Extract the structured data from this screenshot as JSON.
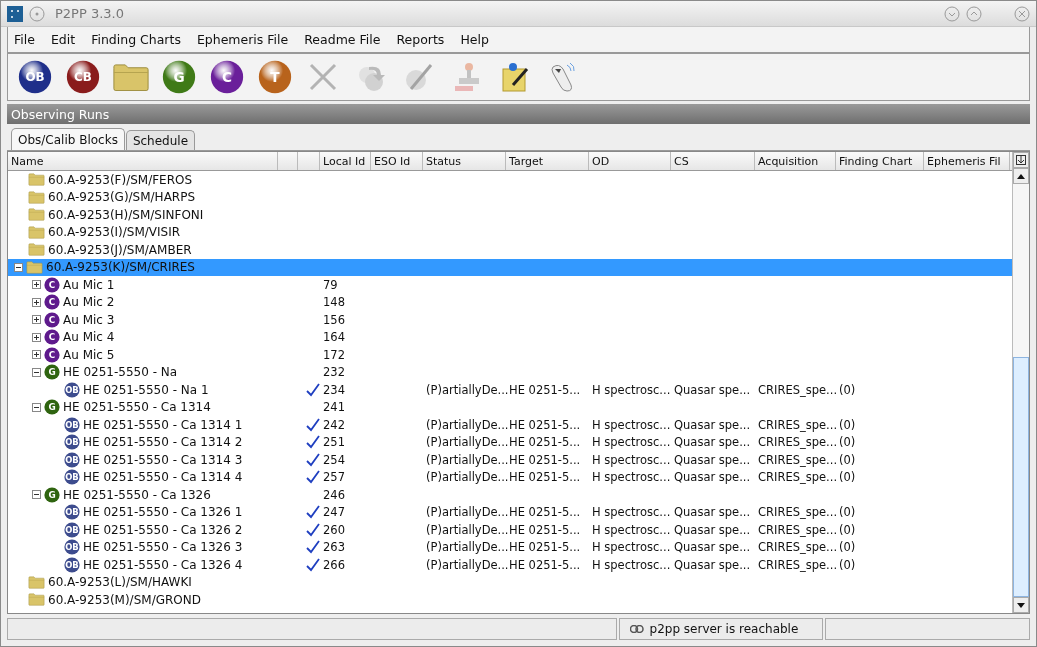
{
  "window": {
    "title": "P2PP 3.3.0"
  },
  "menu": [
    "File",
    "Edit",
    "Finding Charts",
    "Ephemeris File",
    "Readme File",
    "Reports",
    "Help"
  ],
  "toolbar": [
    {
      "kind": "ball",
      "label": "OB",
      "color": "#1f2f8a",
      "disabled": false
    },
    {
      "kind": "ball",
      "label": "CB",
      "color": "#8a1c1c",
      "disabled": false
    },
    {
      "kind": "folder",
      "disabled": false
    },
    {
      "kind": "ball",
      "label": "G",
      "color": "#3f7a17",
      "disabled": false
    },
    {
      "kind": "ball",
      "label": "C",
      "color": "#6a1f9a",
      "disabled": false
    },
    {
      "kind": "ball",
      "label": "T",
      "color": "#b8631c",
      "disabled": false
    },
    {
      "kind": "delete",
      "disabled": true
    },
    {
      "kind": "refresh",
      "disabled": true
    },
    {
      "kind": "edit",
      "disabled": true
    },
    {
      "kind": "stamp",
      "disabled": true
    },
    {
      "kind": "note",
      "disabled": false
    },
    {
      "kind": "device",
      "disabled": false
    }
  ],
  "panel": {
    "title": "Observing Runs"
  },
  "tabs": [
    {
      "label": "Obs/Calib Blocks",
      "selected": true
    },
    {
      "label": "Schedule",
      "selected": false
    }
  ],
  "table": {
    "columns": [
      "Name",
      "",
      "",
      "Local Id",
      "ESO Id",
      "Status",
      "Target",
      "OD",
      "CS",
      "Acquisition",
      "Finding Chart",
      "Ephemeris Fil"
    ],
    "rows": [
      {
        "kind": "folder",
        "name": "60.A-9253(F)/SM/FEROS",
        "selected": false
      },
      {
        "kind": "folder",
        "name": "60.A-9253(G)/SM/HARPS",
        "selected": false
      },
      {
        "kind": "folder",
        "name": "60.A-9253(H)/SM/SINFONI",
        "selected": false
      },
      {
        "kind": "folder",
        "name": "60.A-9253(I)/SM/VISIR",
        "selected": false
      },
      {
        "kind": "folder",
        "name": "60.A-9253(J)/SM/AMBER",
        "selected": false
      },
      {
        "kind": "folder",
        "name": "60.A-9253(K)/SM/CRIRES",
        "selected": true,
        "expanded": true,
        "children": [
          {
            "kind": "calib",
            "badge": "C",
            "name": "Au Mic 1",
            "local_id": "79",
            "selected": false,
            "expanded": false
          },
          {
            "kind": "calib",
            "badge": "C",
            "name": "Au Mic 2",
            "local_id": "148",
            "selected": false,
            "expanded": false
          },
          {
            "kind": "calib",
            "badge": "C",
            "name": "Au Mic 3",
            "local_id": "156",
            "selected": false,
            "expanded": false
          },
          {
            "kind": "calib",
            "badge": "C",
            "name": "Au Mic 4",
            "local_id": "164",
            "selected": false,
            "expanded": false
          },
          {
            "kind": "calib",
            "badge": "C",
            "name": "Au Mic 5",
            "local_id": "172",
            "selected": false,
            "expanded": false
          },
          {
            "kind": "group",
            "badge": "G",
            "name": "HE 0251-5550 - Na",
            "local_id": "232",
            "selected": false,
            "expanded": true,
            "children": [
              {
                "kind": "ob",
                "badge": "OB",
                "name": "HE 0251-5550 - Na 1",
                "checked": true,
                "local_id": "234",
                "status": "(P)artiallyDe...",
                "target": "HE 0251-5...",
                "od": "H spectrosc...",
                "cs": "Quasar spe...",
                "acquisition": "CRIRES_spe...",
                "finding_charts": "(0)",
                "selected": false
              }
            ]
          },
          {
            "kind": "group",
            "badge": "G",
            "name": "HE 0251-5550 - Ca 1314",
            "local_id": "241",
            "selected": false,
            "expanded": true,
            "children": [
              {
                "kind": "ob",
                "badge": "OB",
                "name": "HE 0251-5550 - Ca 1314 1",
                "checked": true,
                "local_id": "242",
                "status": "(P)artiallyDe...",
                "target": "HE 0251-5...",
                "od": "H spectrosc...",
                "cs": "Quasar spe...",
                "acquisition": "CRIRES_spe...",
                "finding_charts": "(0)",
                "selected": false
              },
              {
                "kind": "ob",
                "badge": "OB",
                "name": "HE 0251-5550 - Ca 1314 2",
                "checked": true,
                "local_id": "251",
                "status": "(P)artiallyDe...",
                "target": "HE 0251-5...",
                "od": "H spectrosc...",
                "cs": "Quasar spe...",
                "acquisition": "CRIRES_spe...",
                "finding_charts": "(0)",
                "selected": false
              },
              {
                "kind": "ob",
                "badge": "OB",
                "name": "HE 0251-5550 - Ca 1314 3",
                "checked": true,
                "local_id": "254",
                "status": "(P)artiallyDe...",
                "target": "HE 0251-5...",
                "od": "H spectrosc...",
                "cs": "Quasar spe...",
                "acquisition": "CRIRES_spe...",
                "finding_charts": "(0)",
                "selected": false
              },
              {
                "kind": "ob",
                "badge": "OB",
                "name": "HE 0251-5550 - Ca 1314 4",
                "checked": true,
                "local_id": "257",
                "status": "(P)artiallyDe...",
                "target": "HE 0251-5...",
                "od": "H spectrosc...",
                "cs": "Quasar spe...",
                "acquisition": "CRIRES_spe...",
                "finding_charts": "(0)",
                "selected": false
              }
            ]
          },
          {
            "kind": "group",
            "badge": "G",
            "name": "HE 0251-5550 - Ca 1326",
            "local_id": "246",
            "selected": false,
            "expanded": true,
            "children": [
              {
                "kind": "ob",
                "badge": "OB",
                "name": "HE 0251-5550 - Ca 1326 1",
                "checked": true,
                "local_id": "247",
                "status": "(P)artiallyDe...",
                "target": "HE 0251-5...",
                "od": "H spectrosc...",
                "cs": "Quasar spe...",
                "acquisition": "CRIRES_spe...",
                "finding_charts": "(0)",
                "selected": false
              },
              {
                "kind": "ob",
                "badge": "OB",
                "name": "HE 0251-5550 - Ca 1326 2",
                "checked": true,
                "local_id": "260",
                "status": "(P)artiallyDe...",
                "target": "HE 0251-5...",
                "od": "H spectrosc...",
                "cs": "Quasar spe...",
                "acquisition": "CRIRES_spe...",
                "finding_charts": "(0)",
                "selected": false
              },
              {
                "kind": "ob",
                "badge": "OB",
                "name": "HE 0251-5550 - Ca 1326 3",
                "checked": true,
                "local_id": "263",
                "status": "(P)artiallyDe...",
                "target": "HE 0251-5...",
                "od": "H spectrosc...",
                "cs": "Quasar spe...",
                "acquisition": "CRIRES_spe...",
                "finding_charts": "(0)",
                "selected": false
              },
              {
                "kind": "ob",
                "badge": "OB",
                "name": "HE 0251-5550 - Ca 1326 4",
                "checked": true,
                "local_id": "266",
                "status": "(P)artiallyDe...",
                "target": "HE 0251-5...",
                "od": "H spectrosc...",
                "cs": "Quasar spe...",
                "acquisition": "CRIRES_spe...",
                "finding_charts": "(0)",
                "selected": false
              }
            ]
          }
        ]
      },
      {
        "kind": "folder",
        "name": "60.A-9253(L)/SM/HAWKI",
        "selected": false
      },
      {
        "kind": "folder",
        "name": "60.A-9253(M)/SM/GROND",
        "selected": false
      }
    ]
  },
  "status_bar": {
    "message": "p2pp server is reachable"
  }
}
